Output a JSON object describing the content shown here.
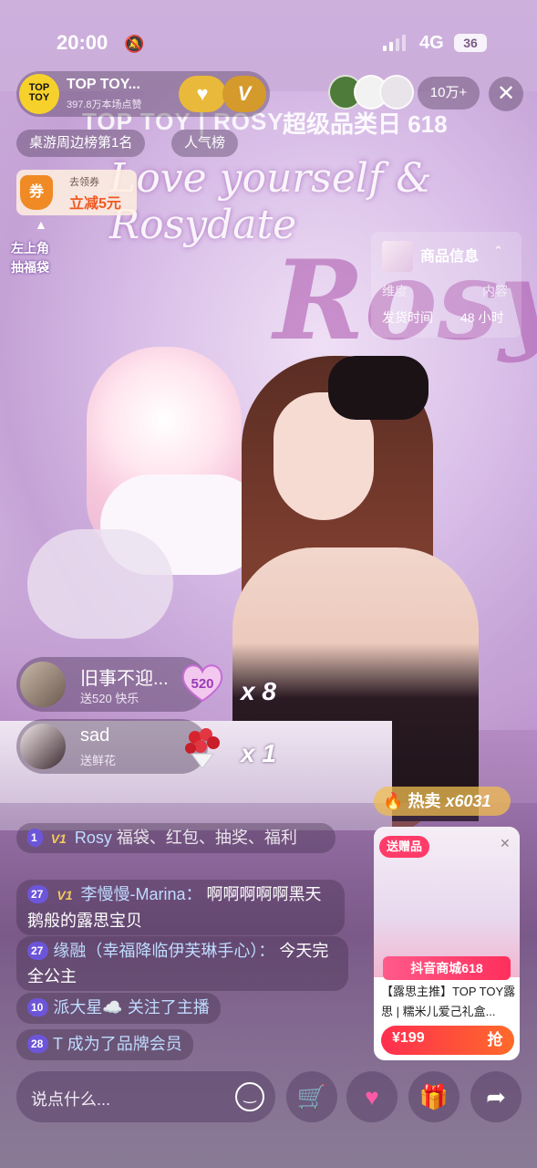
{
  "status": {
    "time": "20:00",
    "network": "4G",
    "battery": "36"
  },
  "host": {
    "name": "TOP TOY...",
    "likes": "397.8万本场点赞",
    "logo_text": "TOP TOY"
  },
  "follow": {
    "v_label": "V"
  },
  "viewers": {
    "count": "10万+"
  },
  "tags": {
    "rank": "桌游周边榜第1名",
    "popular": "人气榜"
  },
  "coupon": {
    "icon": "券",
    "line1": "去领券",
    "line2": "立减5元"
  },
  "lucky_bag": {
    "line1": "左上角",
    "line2": "抽福袋"
  },
  "background": {
    "brand": "TOP TOY | ROSY",
    "event": "超级品类日 618",
    "script": "Love yourself & Rosydate",
    "logo": "Rosy"
  },
  "product_info": {
    "title": "商品信息",
    "row1_key": "维度",
    "row1_val": "内容",
    "row2_key": "发货时间",
    "row2_val": "48 小时"
  },
  "gifts": [
    {
      "name": "旧事不迎...",
      "desc": "送520 快乐",
      "count": "x 8"
    },
    {
      "name": "sad",
      "desc": "送鲜花",
      "count": "x 1"
    }
  ],
  "comments": [
    {
      "level": "1",
      "vip": "V1",
      "name": "Rosy",
      "text": "福袋、红包、抽奖、福利"
    },
    {
      "level": "27",
      "vip": "V1",
      "name": "李慢慢-Marina：",
      "text": "啊啊啊啊啊黑天鹅般的露思宝贝"
    },
    {
      "level": "27",
      "name": "缘融（幸福降临伊芙琳手心）：",
      "text": "今天完全公主"
    },
    {
      "level": "10",
      "name": "派大星☁️",
      "text": "关注了主播"
    },
    {
      "level": "28",
      "name": "T",
      "text": "成为了品牌会员"
    }
  ],
  "hot_sale": {
    "label": "热卖",
    "count": "x6031"
  },
  "product_card": {
    "gift_tag": "送赠品",
    "banner": "抖音商城618",
    "title": "【露思主推】TOP TOY露思 | 糯米儿爱己礼盒...",
    "price": "¥199",
    "buy": "抢"
  },
  "input": {
    "placeholder": "说点什么..."
  },
  "colors": {
    "accent": "#ff2f4f",
    "badge": "#6d55d9",
    "gold": "#e8b93a"
  }
}
